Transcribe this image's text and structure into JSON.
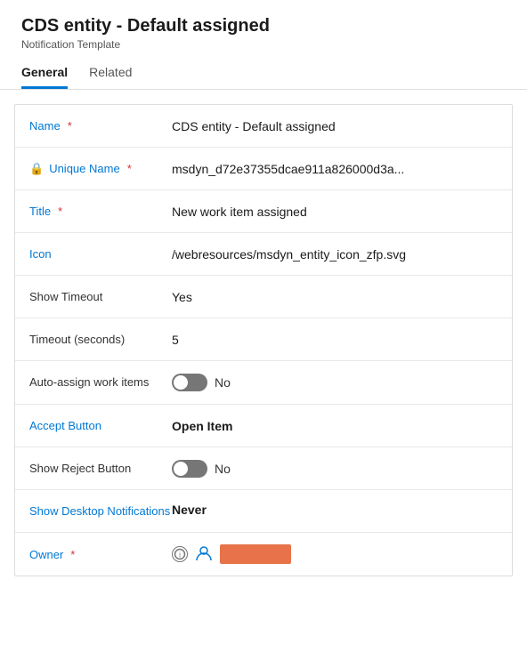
{
  "header": {
    "title": "CDS entity - Default assigned",
    "subtitle": "Notification Template"
  },
  "tabs": [
    {
      "id": "general",
      "label": "General",
      "active": true
    },
    {
      "id": "related",
      "label": "Related",
      "active": false
    }
  ],
  "fields": [
    {
      "id": "name",
      "label": "Name",
      "required": true,
      "labelColor": "blue",
      "value": "CDS entity - Default assigned",
      "bold": false,
      "type": "text"
    },
    {
      "id": "unique-name",
      "label": "Unique Name",
      "required": true,
      "labelColor": "blue",
      "hasLock": true,
      "value": "msdyn_d72e37355dcae911a826000d3a...",
      "bold": false,
      "type": "text-truncated"
    },
    {
      "id": "title",
      "label": "Title",
      "required": true,
      "labelColor": "blue",
      "value": "New work item assigned",
      "bold": false,
      "type": "text"
    },
    {
      "id": "icon",
      "label": "Icon",
      "required": false,
      "labelColor": "blue",
      "value": "/webresources/msdyn_entity_icon_zfp.svg",
      "bold": false,
      "type": "text"
    },
    {
      "id": "show-timeout",
      "label": "Show Timeout",
      "required": false,
      "labelColor": "black",
      "value": "Yes",
      "bold": false,
      "type": "text"
    },
    {
      "id": "timeout-seconds",
      "label": "Timeout (seconds)",
      "required": false,
      "labelColor": "black",
      "value": "5",
      "bold": false,
      "type": "text"
    },
    {
      "id": "auto-assign",
      "label": "Auto-assign work items",
      "required": false,
      "labelColor": "black",
      "value": "No",
      "bold": false,
      "type": "toggle"
    },
    {
      "id": "accept-button",
      "label": "Accept Button",
      "required": false,
      "labelColor": "blue",
      "value": "Open Item",
      "bold": true,
      "type": "text"
    },
    {
      "id": "show-reject",
      "label": "Show Reject Button",
      "required": false,
      "labelColor": "black",
      "value": "No",
      "bold": false,
      "type": "toggle"
    },
    {
      "id": "show-desktop",
      "label": "Show Desktop Notifications",
      "required": false,
      "labelColor": "blue",
      "value": "Never",
      "bold": true,
      "type": "text"
    },
    {
      "id": "owner",
      "label": "Owner",
      "required": true,
      "labelColor": "blue",
      "value": "",
      "bold": false,
      "type": "owner"
    }
  ]
}
